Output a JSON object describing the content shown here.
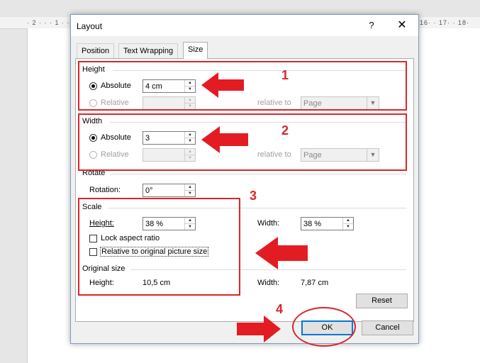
{
  "ruler": {
    "left_marks": "· 2 · · · 1 · ·",
    "right_marks": "16· · 17· · 18·"
  },
  "dialog": {
    "title": "Layout",
    "help": "?",
    "close": "✕",
    "tabs": [
      {
        "label": "Position"
      },
      {
        "label": "Text Wrapping"
      },
      {
        "label": "Size"
      }
    ],
    "height": {
      "group_label": "Height",
      "absolute_label": "Absolute",
      "absolute_value": "4 cm",
      "relative_label": "Relative",
      "relative_value": "",
      "relative_to_label": "relative to",
      "relative_to_value": "Page"
    },
    "width": {
      "group_label": "Width",
      "absolute_label": "Absolute",
      "absolute_value": "3",
      "relative_label": "Relative",
      "relative_value": "",
      "relative_to_label": "relative to",
      "relative_to_value": "Page"
    },
    "rotate": {
      "group_label": "Rotate",
      "rotation_label": "Rotation:",
      "rotation_value": "0°"
    },
    "scale": {
      "group_label": "Scale",
      "height_label": "Height:",
      "height_value": "38 %",
      "width_label": "Width:",
      "width_value": "38 %",
      "lock_aspect_label": "Lock aspect ratio",
      "relative_original_label": "Relative to original picture size"
    },
    "original_size": {
      "group_label": "Original size",
      "height_label": "Height:",
      "height_value": "10,5 cm",
      "width_label": "Width:",
      "width_value": "7,87 cm"
    },
    "reset_label": "Reset",
    "ok_label": "OK",
    "cancel_label": "Cancel"
  },
  "annotations": {
    "n1": "1",
    "n2": "2",
    "n3": "3",
    "n4": "4",
    "color": "#d9262c"
  }
}
